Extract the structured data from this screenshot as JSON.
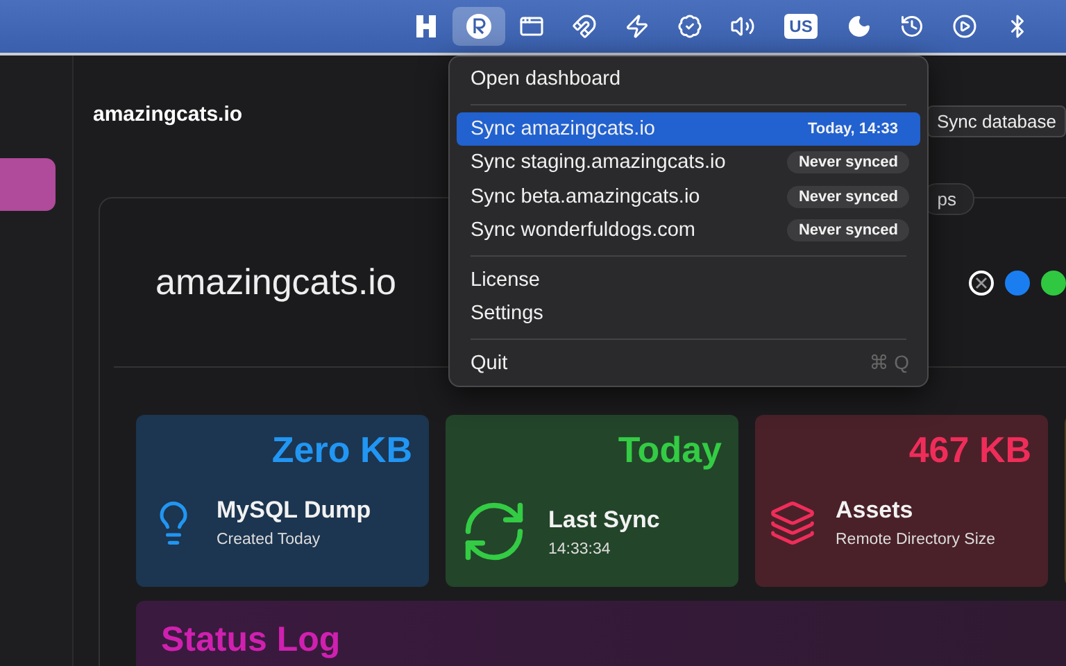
{
  "menu_bar": {
    "items": [
      {
        "kind": "h-logo",
        "selected": false
      },
      {
        "kind": "app",
        "selected": true
      },
      {
        "kind": "window",
        "selected": false
      },
      {
        "kind": "magnet",
        "selected": false
      },
      {
        "kind": "bolt",
        "selected": false
      },
      {
        "kind": "check",
        "selected": false
      },
      {
        "kind": "volume",
        "selected": false
      },
      {
        "kind": "keyboard",
        "label": "US",
        "selected": false
      },
      {
        "kind": "moon",
        "selected": false
      },
      {
        "kind": "history",
        "selected": false
      },
      {
        "kind": "play",
        "selected": false
      },
      {
        "kind": "bluetooth",
        "selected": false
      }
    ]
  },
  "header": {
    "title": "amazingcats.io",
    "button": "Sync database"
  },
  "site_panel": {
    "tab": "ps",
    "title": "amazingcats.io"
  },
  "stats": [
    {
      "kind": "bulb",
      "value": "Zero KB",
      "label": "MySQL Dump",
      "detail": "Created Today",
      "color": "#2196f3"
    },
    {
      "kind": "sync",
      "value": "Today",
      "label": "Last Sync",
      "detail": "14:33:34",
      "color": "#33cc44"
    },
    {
      "kind": "layers",
      "value": "467 KB",
      "label": "Assets",
      "detail": "Remote Directory Size",
      "color": "#f02d5a"
    }
  ],
  "status_log": {
    "title": "Status Log"
  },
  "menu": {
    "sections": [
      {
        "items": [
          {
            "label": "Open dashboard",
            "selected": false
          }
        ]
      },
      {
        "items": [
          {
            "label": "Sync amazingcats.io",
            "badge": "Today, 14:33",
            "selected": true
          },
          {
            "label": "Sync staging.amazingcats.io",
            "badge": "Never synced",
            "selected": false
          },
          {
            "label": "Sync beta.amazingcats.io",
            "badge": "Never synced",
            "selected": false
          },
          {
            "label": "Sync wonderfuldogs.com",
            "badge": "Never synced",
            "selected": false
          }
        ]
      },
      {
        "items": [
          {
            "label": "License",
            "selected": false
          },
          {
            "label": "Settings",
            "selected": false
          }
        ]
      },
      {
        "items": [
          {
            "label": "Quit",
            "shortcut": "⌘ Q",
            "selected": false
          }
        ]
      }
    ]
  }
}
